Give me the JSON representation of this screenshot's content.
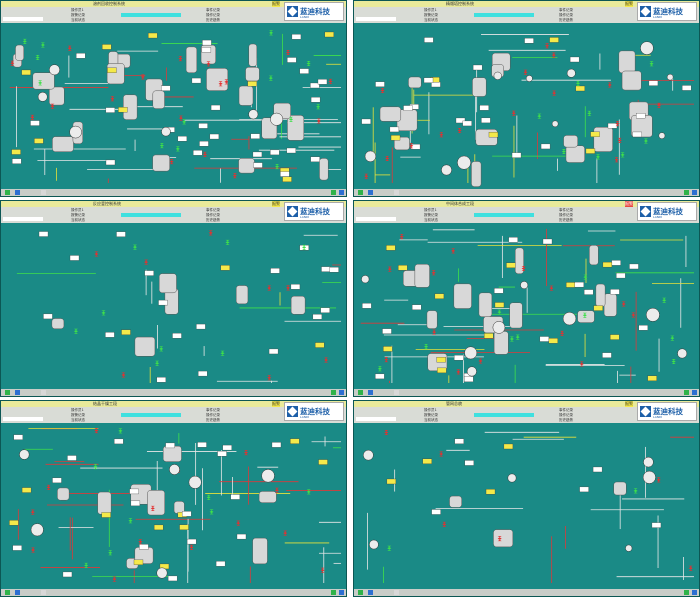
{
  "brand": {
    "name": "蓝迪科技",
    "tagline": "LANDI"
  },
  "panels": [
    {
      "id": "1",
      "title": "溶剂回收控制系统",
      "stat_label": "报警",
      "stat_color": "yel",
      "rows": [
        "操作员1",
        "报警记录",
        "当前状态",
        "事件记录",
        "操作记录",
        "历史趋势"
      ]
    },
    {
      "id": "2",
      "title": "精馏塔控制系统",
      "stat_label": "报警",
      "stat_color": "yel",
      "rows": [
        "操作员1",
        "报警记录",
        "当前状态",
        "事件记录",
        "操作记录",
        "历史趋势"
      ]
    },
    {
      "id": "3",
      "title": "反应釜控制系统",
      "stat_label": "报警",
      "stat_color": "yel",
      "rows": [
        "操作员1",
        "报警记录",
        "当前状态",
        "事件记录",
        "操作记录",
        "历史趋势"
      ]
    },
    {
      "id": "4",
      "title": "中间体合成工段",
      "stat_label": "报警",
      "stat_color": "red",
      "rows": [
        "操作员1",
        "报警记录",
        "当前状态",
        "事件记录",
        "操作记录",
        "历史趋势"
      ]
    },
    {
      "id": "5",
      "title": "结晶干燥工段",
      "stat_label": "报警",
      "stat_color": "yel",
      "rows": [
        "操作员1",
        "报警记录",
        "当前状态",
        "事件记录",
        "操作记录",
        "历史趋势"
      ]
    },
    {
      "id": "6",
      "title": "管网总貌",
      "stat_label": "报警",
      "stat_color": "yel",
      "rows": [
        "操作员1",
        "报警记录",
        "当前状态",
        "事件记录",
        "操作记录",
        "历史趋势"
      ]
    }
  ],
  "colors": {
    "bg": "#1a8a86",
    "pipe_white": "#e8e8e8",
    "pipe_yellow": "#e6e23a",
    "pipe_red": "#d93b3b",
    "pipe_green": "#3ee04a",
    "vessel": "#d8d8d8",
    "valve_red": "#e23232"
  }
}
